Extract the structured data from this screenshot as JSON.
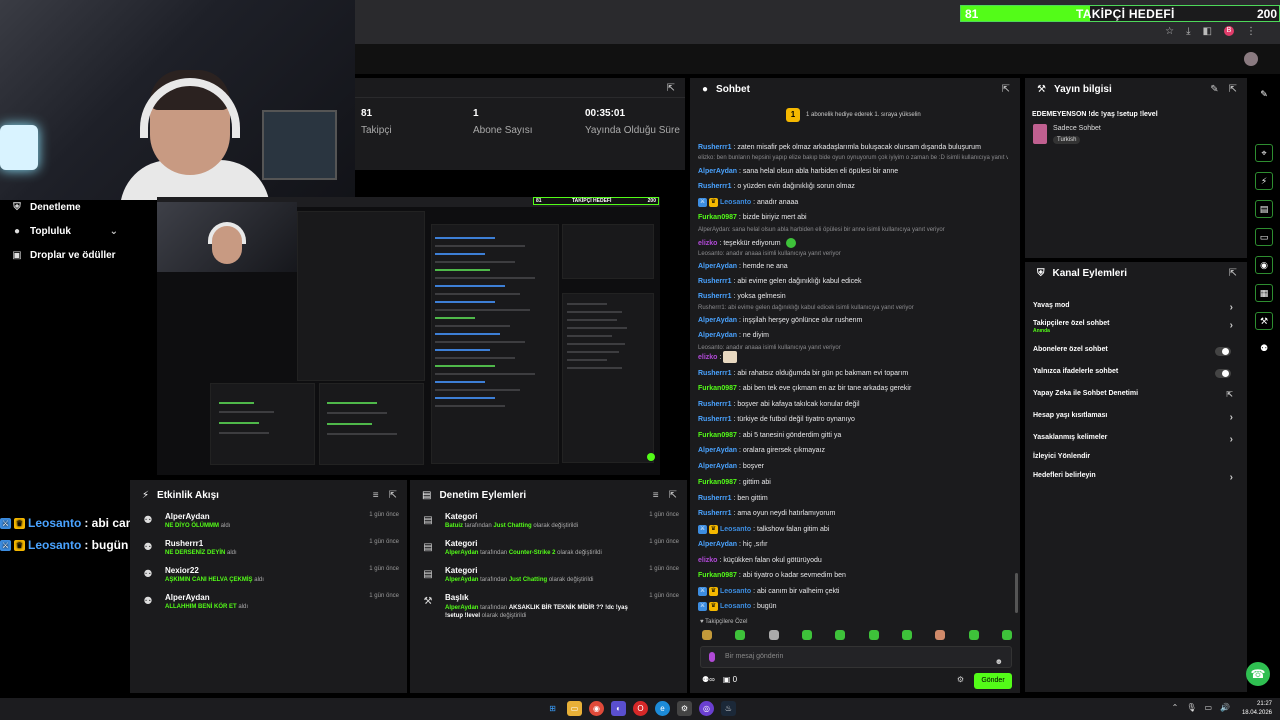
{
  "goal": {
    "current": "81",
    "label": "TAKİPÇİ HEDEFİ",
    "target": "200",
    "progress_fraction": 0.405
  },
  "leftnav": {
    "items": [
      {
        "label": "Denetleme",
        "icon": "shield-icon"
      },
      {
        "label": "Topluluk",
        "icon": "people-icon"
      },
      {
        "label": "Droplar ve ödüller",
        "icon": "gift-icon"
      }
    ]
  },
  "stats": [
    {
      "value": "81",
      "label": "Takipçi"
    },
    {
      "value": "1",
      "label": "Abone Sayısı"
    },
    {
      "value": "00:35:01",
      "label": "Yayında Olduğu Süre"
    }
  ],
  "overlay_chat": [
    {
      "user": "Leosanto",
      "text": ": abi canım bir valheim çekti"
    },
    {
      "user": "Leosanto",
      "text": ": bugün"
    }
  ],
  "activity": {
    "title": "Etkinlik Akışı",
    "items": [
      {
        "user": "AlperAydan",
        "detail_green": "NE DİYO ÖLÜMMM",
        "detail": " aldı",
        "time": "1 gün önce"
      },
      {
        "user": "Rusherrr1",
        "detail_green": "NE DERSENİZ DEYİN",
        "detail": " aldı",
        "time": "1 gün önce"
      },
      {
        "user": "Nexior22",
        "detail_green": "AŞKIMIN CANI HELVA ÇEKMİŞ",
        "detail": " aldı",
        "time": "1 gün önce"
      },
      {
        "user": "AlperAydan",
        "detail_green": "ALLAHHIM BENİ KÖR ET",
        "detail": " aldı",
        "time": "1 gün önce"
      }
    ]
  },
  "moderation": {
    "title": "Denetim Eylemleri",
    "items": [
      {
        "title": "Kategori",
        "actor": "Batuiz",
        "mid": " tarafından ",
        "value": "Just Chatting",
        "tail": " olarak değiştirildi",
        "time": "1 gün önce"
      },
      {
        "title": "Kategori",
        "actor": "AlperAydan",
        "mid": " tarafından ",
        "value": "Counter-Strike 2",
        "tail": " olarak değiştirildi",
        "time": "1 gün önce"
      },
      {
        "title": "Kategori",
        "actor": "AlperAydan",
        "mid": " tarafından ",
        "value": "Just Chatting",
        "tail": " olarak değiştirildi",
        "time": "1 gün önce"
      },
      {
        "title": "Başlık",
        "actor": "AlperAydan",
        "mid": " tarafından ",
        "value": "AKSAKLIK BİR TEKNİK MİDİR ?? !dc !yaş !setup !level",
        "tail": " olarak değiştirildi",
        "time": "1 gün önce"
      }
    ]
  },
  "chat": {
    "title": "Sohbet",
    "pinned": "1 abonelik hediye ederek 1. sıraya yükselin",
    "pinned_rank": "1",
    "messages": [
      {
        "user": "Rusherrr1",
        "color": "#4aa3ff",
        "text": ": zaten misafir pek olmaz arkadaşlarımla buluşacak olursam dışarıda buluşurum"
      },
      {
        "reply": "elizko: ben bunların hepsini yapıp elize bakıp bide oyun oynuyorum çok iyiyim o zaman be :D isimli kullanıcıya yanıt veriyor"
      },
      {
        "user": "AlperAydan",
        "color": "#4aa3ff",
        "text": ": sana helal olsun abla harbiden eli öpülesi bir anne"
      },
      {
        "user": "Rusherrr1",
        "color": "#4aa3ff",
        "text": ": o yüzden evin dağınıklığı sorun olmaz"
      },
      {
        "user": "Leosanto",
        "color": "#3d8de0",
        "badges": true,
        "text": ": anadır anaaa"
      },
      {
        "user": "Furkan0987",
        "color": "#53fc18",
        "text": ": bizde biriyiz mert abi"
      },
      {
        "reply": "AlperAydan: sana helal olsun abla harbiden eli öpülesi bir anne isimli kullanıcıya yanıt veriyor"
      },
      {
        "user": "elizko",
        "color": "#b14ad7",
        "text": ": teşekkür ediyorum"
      },
      {
        "reply": "Leosanto: anadır anaaa isimli kullanıcıya yanıt veriyor"
      },
      {
        "user": "AlperAydan",
        "color": "#4aa3ff",
        "text": ": hemde ne ana"
      },
      {
        "user": "Rusherrr1",
        "color": "#4aa3ff",
        "text": ": abi evime gelen dağınıklığı kabul edicek"
      },
      {
        "user": "Rusherrr1",
        "color": "#4aa3ff",
        "text": ": yoksa gelmesin"
      },
      {
        "reply": "Rusherrr1: abi evime gelen dağınıklığı kabul edicek isimli kullanıcıya yanıt veriyor"
      },
      {
        "user": "AlperAydan",
        "color": "#4aa3ff",
        "text": ": inşşilah herşey gönlünce olur rushenm"
      },
      {
        "user": "AlperAydan",
        "color": "#4aa3ff",
        "text": ": ne diyim"
      },
      {
        "reply": "Leosanto: anadır anaaa isimli kullanıcıya yanıt veriyor"
      },
      {
        "user": "elizko",
        "color": "#b14ad7",
        "text": ":"
      },
      {
        "user": "Rusherrr1",
        "color": "#4aa3ff",
        "text": ": abi rahatsız olduğumda bir gün pc bakmam evi toparım"
      },
      {
        "user": "Furkan0987",
        "color": "#53fc18",
        "text": ": abi ben tek eve çıkmam en az bir tane arkadaş gerekir"
      },
      {
        "user": "Rusherrr1",
        "color": "#4aa3ff",
        "text": ": boşver abi kafaya takılcak konular değil"
      },
      {
        "user": "Rusherrr1",
        "color": "#4aa3ff",
        "text": ": türkiye de futbol değil tiyatro oynanıyo"
      },
      {
        "user": "Furkan0987",
        "color": "#53fc18",
        "text": ": abi 5 tanesini gönderdim gitti ya"
      },
      {
        "user": "AlperAydan",
        "color": "#4aa3ff",
        "text": ": oralara girersek çıkmayaız"
      },
      {
        "user": "AlperAydan",
        "color": "#4aa3ff",
        "text": ": boşver"
      },
      {
        "user": "Furkan0987",
        "color": "#53fc18",
        "text": ": gittim abi"
      },
      {
        "user": "Rusherrr1",
        "color": "#4aa3ff",
        "text": ": ben gittim"
      },
      {
        "user": "Rusherrr1",
        "color": "#4aa3ff",
        "text": ": ama oyun neydi hatırlamıyorum"
      },
      {
        "user": "Leosanto",
        "color": "#3d8de0",
        "badges": true,
        "text": ": talkshow falan gitim abi"
      },
      {
        "user": "AlperAydan",
        "color": "#4aa3ff",
        "text": ": hiç ,sıfır"
      },
      {
        "user": "elizko",
        "color": "#b14ad7",
        "text": ": küçükken falan okul götürüyodu"
      },
      {
        "user": "Furkan0987",
        "color": "#53fc18",
        "text": ": abi tiyatro o kadar sevmedim ben"
      },
      {
        "user": "Leosanto",
        "color": "#3d8de0",
        "badges": true,
        "text": ": abi canım bir valheim çekti"
      },
      {
        "user": "Leosanto",
        "color": "#3d8de0",
        "badges": true,
        "text": ": bugün"
      }
    ],
    "followers_only": "Takipçilere Özel",
    "input_placeholder": "Bir mesaj gönderin",
    "send_label": "Gönder",
    "viewer_count": "0"
  },
  "stream_info": {
    "title": "Yayın bilgisi",
    "stream_title": "EDEMEYENSON !dc !yaş !setup !level",
    "category": "Sadece Sohbet",
    "tag": "Turkish"
  },
  "channel_actions": {
    "title": "Kanal Eylemleri",
    "rows": [
      {
        "label": "Yavaş mod",
        "control": "chevron"
      },
      {
        "label": "Takipçilere özel sohbet",
        "sub": "Anında",
        "control": "chevron"
      },
      {
        "label": "Abonelere özel sohbet",
        "control": "toggle"
      },
      {
        "label": "Yalnızca ifadelerle sohbet",
        "control": "toggle"
      },
      {
        "label": "Yapay Zeka ile Sohbet Denetimi",
        "control": "external"
      },
      {
        "label": "Hesap yaşı kısıtlaması",
        "control": "chevron"
      },
      {
        "label": "Yasaklanmış kelimeler",
        "control": "chevron"
      },
      {
        "label": "İzleyici Yönlendir",
        "control": "none"
      },
      {
        "label": "Hedefleri belirleyin",
        "control": "chevron"
      }
    ]
  },
  "taskbar": {
    "time": "21:27",
    "date": "18.04.2026"
  },
  "colors": {
    "accent": "#53fc18",
    "panel": "#1b1b1d",
    "background": "#000000"
  }
}
